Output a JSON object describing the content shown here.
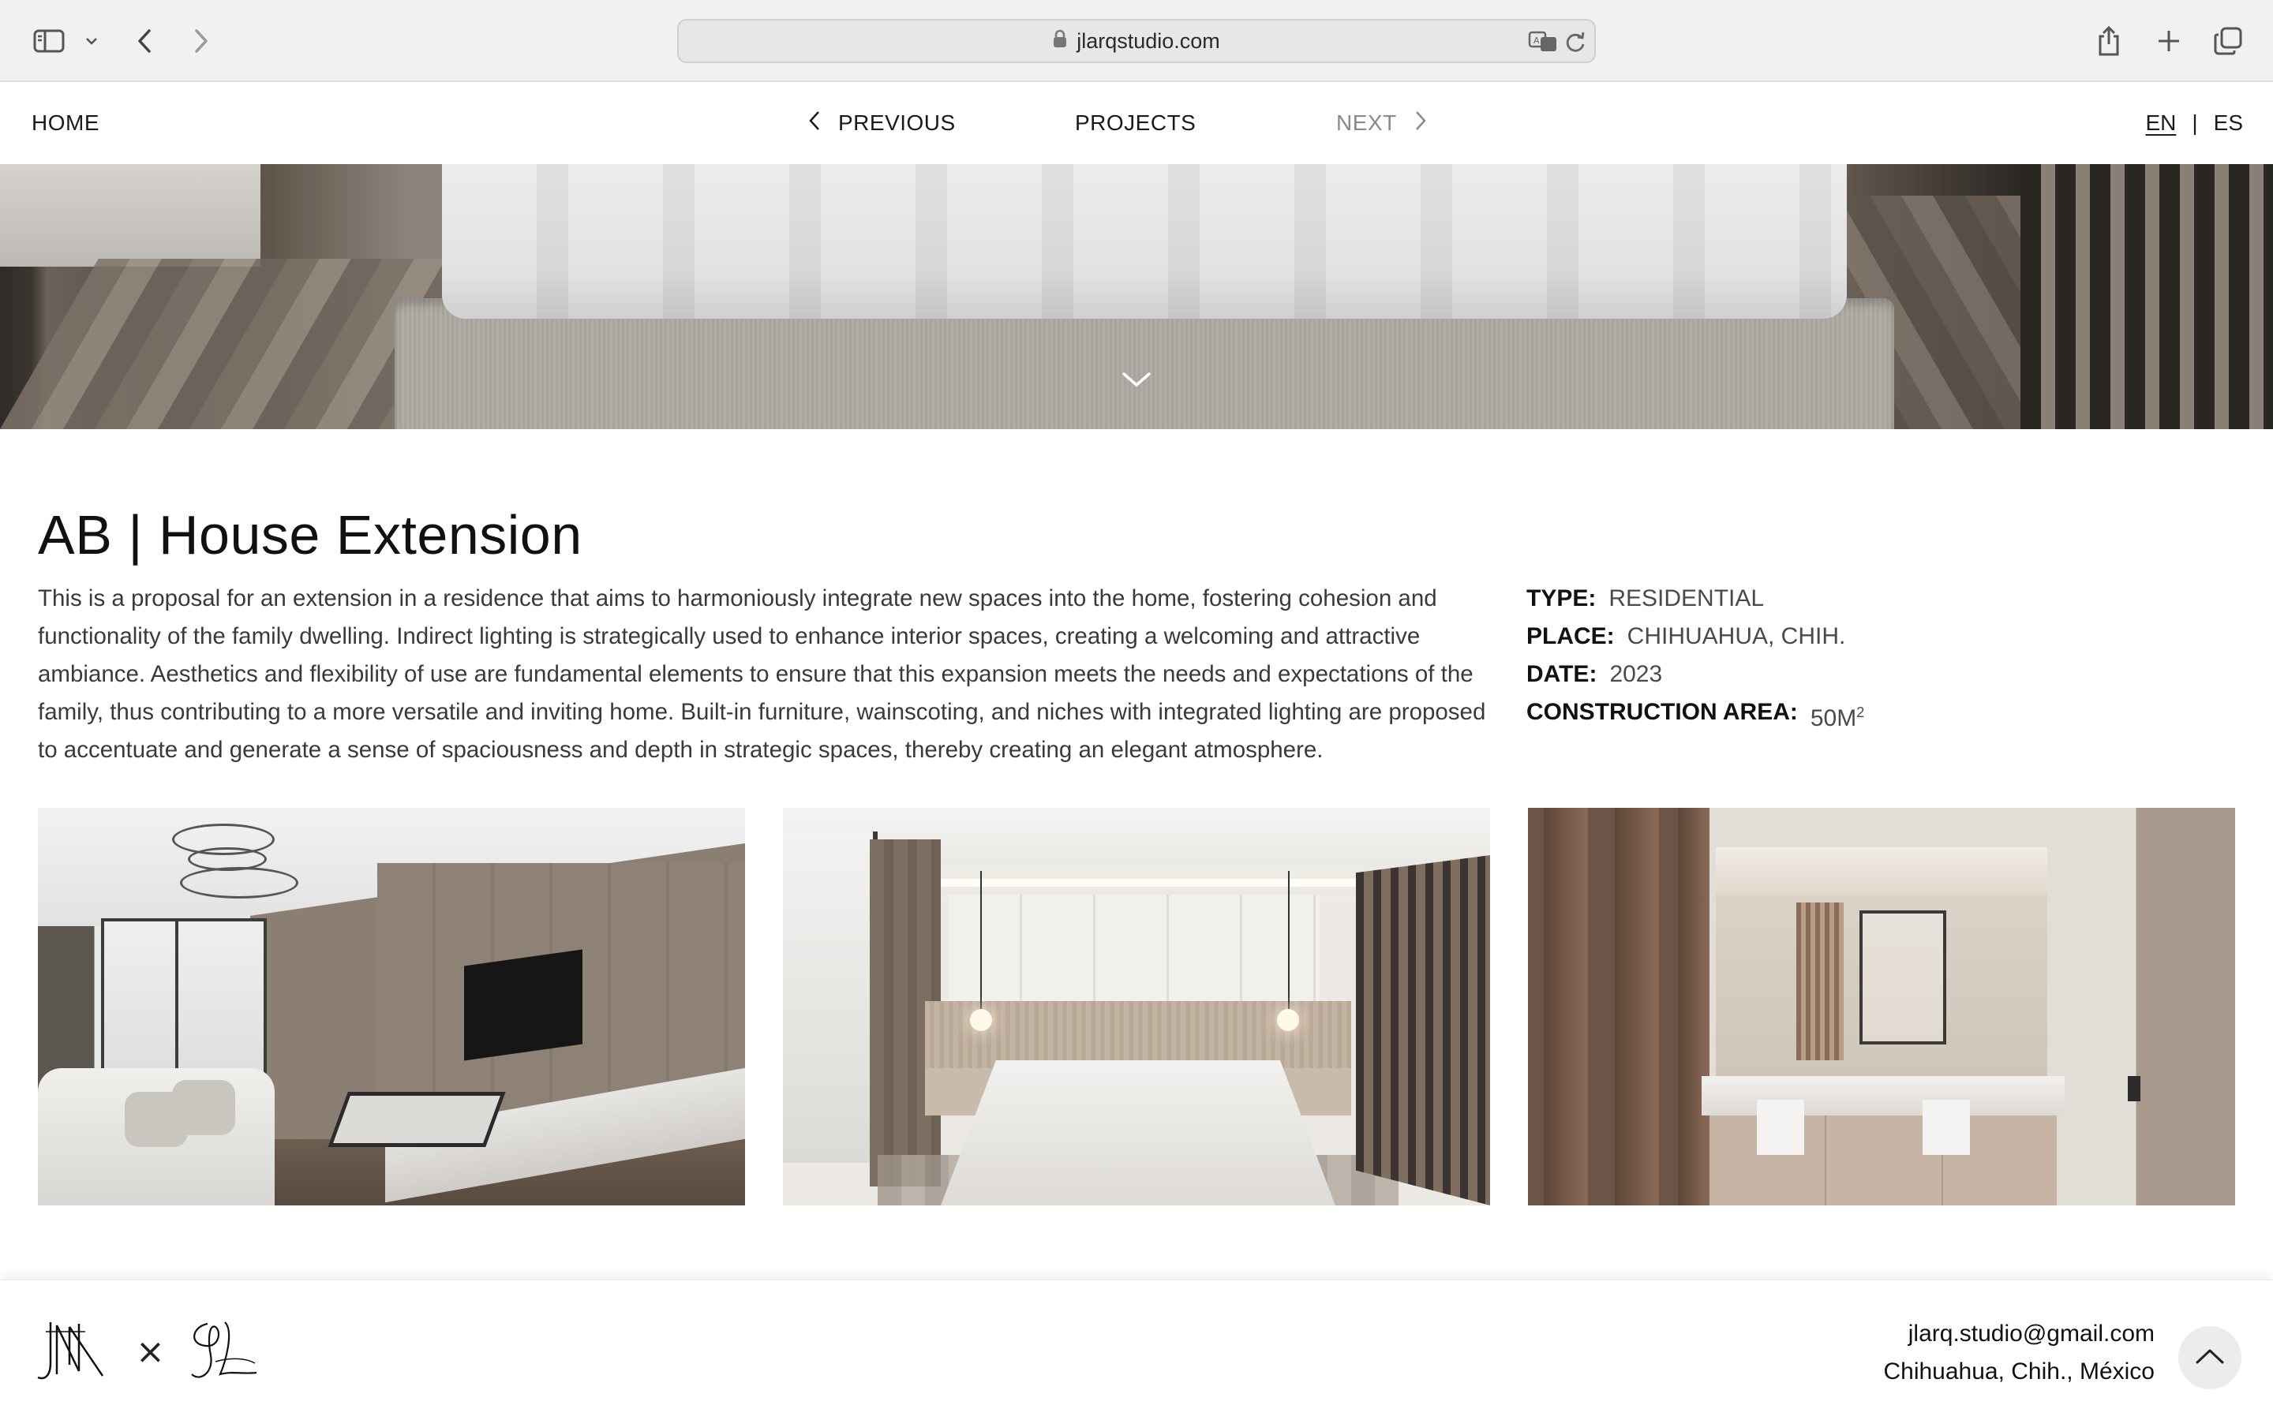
{
  "browser": {
    "url": "jlarqstudio.com",
    "icons": [
      "sidebar-icon",
      "chevron-down-icon",
      "back-icon",
      "forward-icon",
      "lock-icon",
      "translate-icon",
      "reload-icon",
      "share-icon",
      "new-tab-icon",
      "tabs-overview-icon"
    ]
  },
  "nav": {
    "home": "HOME",
    "previous": "PREVIOUS",
    "projects": "PROJECTS",
    "next": "NEXT",
    "lang_en": "EN",
    "lang_sep": "|",
    "lang_es": "ES"
  },
  "project": {
    "title": "AB | House Extension",
    "description": "This is a proposal for an extension in a residence that aims to harmoniously integrate new spaces into the home, fostering cohesion and functionality of the family dwelling. Indirect lighting is strategically used to enhance interior spaces, creating a welcoming and attractive ambiance. Aesthetics and flexibility of use are fundamental elements to ensure that this expansion meets the needs and expectations of the family, thus contributing to a more versatile and inviting home. Built-in furniture, wainscoting, and niches with integrated lighting are proposed to accentuate and generate a sense of spaciousness and depth in strategic spaces, thereby creating an elegant atmosphere.",
    "info": {
      "type_label": "TYPE:",
      "type_value": "RESIDENTIAL",
      "place_label": "PLACE:",
      "place_value": "CHIHUAHUA, CHIH.",
      "date_label": "DATE:",
      "date_value": "2023",
      "area_label": "CONSTRUCTION AREA:",
      "area_value": "50M",
      "area_sup": "2"
    }
  },
  "footer": {
    "logo_separator": "×",
    "email": "jlarq.studio@gmail.com",
    "location": "Chihuahua, Chih., México"
  },
  "colors": {
    "chrome_bg": "#f1f1f1",
    "text": "#1c1c1c",
    "muted_text": "#8a8a8a"
  }
}
